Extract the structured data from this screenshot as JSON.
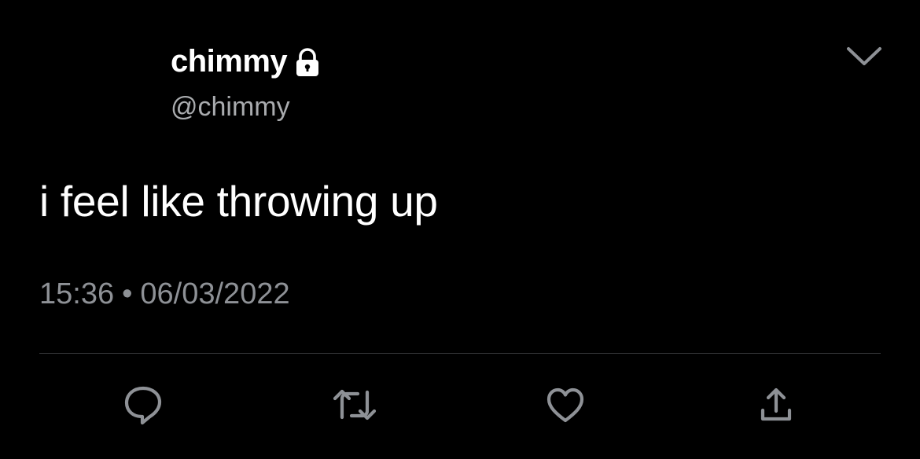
{
  "tweet": {
    "display_name": "chimmy",
    "handle": "@chimmy",
    "protected_icon": "lock-icon",
    "text": "i feel like throwing up",
    "time": "15:36",
    "separator": "•",
    "date": "06/03/2022"
  },
  "actions": [
    {
      "name": "reply",
      "icon": "reply-bubble-icon"
    },
    {
      "name": "retweet",
      "icon": "retweet-icon"
    },
    {
      "name": "like",
      "icon": "heart-icon"
    },
    {
      "name": "share",
      "icon": "share-icon"
    }
  ],
  "colors": {
    "background": "#000000",
    "primary_text": "#ffffff",
    "secondary_text": "#8e9196",
    "icon": "#8e9196",
    "divider": "#3a3b3e"
  }
}
